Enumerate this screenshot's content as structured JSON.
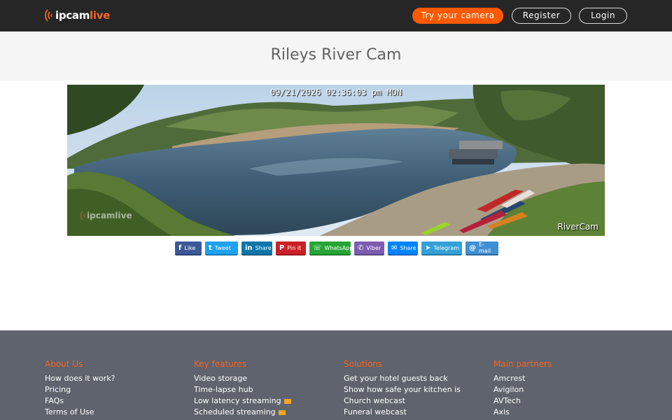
{
  "header": {
    "logo": {
      "prefix": "ipcam",
      "suffix": "live",
      "icon": "signal-waves-icon"
    },
    "buttons": {
      "try": "Try your camera",
      "register": "Register",
      "login": "Login"
    },
    "colors": {
      "accent": "#ff5a00",
      "bar": "#262626"
    }
  },
  "page": {
    "title": "Rileys River Cam"
  },
  "camera": {
    "timestamp": "09/21/2026 02:36:03 pm MON",
    "label": "RiverCam",
    "watermark": "ipcamlive"
  },
  "share": [
    {
      "label": "Like",
      "icon": "facebook-icon",
      "glyph": "f"
    },
    {
      "label": "Tweet",
      "icon": "twitter-icon",
      "glyph": "t"
    },
    {
      "label": "Share",
      "icon": "linkedin-icon",
      "glyph": "in"
    },
    {
      "label": "Pin it",
      "icon": "pinterest-icon",
      "glyph": "P"
    },
    {
      "label": "WhatsApp",
      "icon": "whatsapp-icon",
      "glyph": "☏"
    },
    {
      "label": "Viber",
      "icon": "viber-icon",
      "glyph": "✆"
    },
    {
      "label": "Share",
      "icon": "messenger-icon",
      "glyph": "✉"
    },
    {
      "label": "Telegram",
      "icon": "telegram-icon",
      "glyph": "➤"
    },
    {
      "label": "E-mail",
      "icon": "email-icon",
      "glyph": "@"
    }
  ],
  "footer": {
    "columns": [
      {
        "heading": "About Us",
        "links": [
          "How does it work?",
          "Pricing",
          "FAQs",
          "Terms of Use"
        ]
      },
      {
        "heading": "Key features",
        "links": [
          "Video storage",
          "Time-lapse hub",
          "Low latency streaming",
          "Scheduled streaming"
        ],
        "new_badges": [
          false,
          false,
          true,
          true
        ]
      },
      {
        "heading": "Solutions",
        "links": [
          "Get your hotel guests back",
          "Show how safe your kitchen is",
          "Church webcast",
          "Funeral webcast"
        ]
      },
      {
        "heading": "Main partners",
        "links": [
          "Amcrest",
          "Avigilon",
          "AVTech",
          "Axis"
        ]
      }
    ]
  }
}
